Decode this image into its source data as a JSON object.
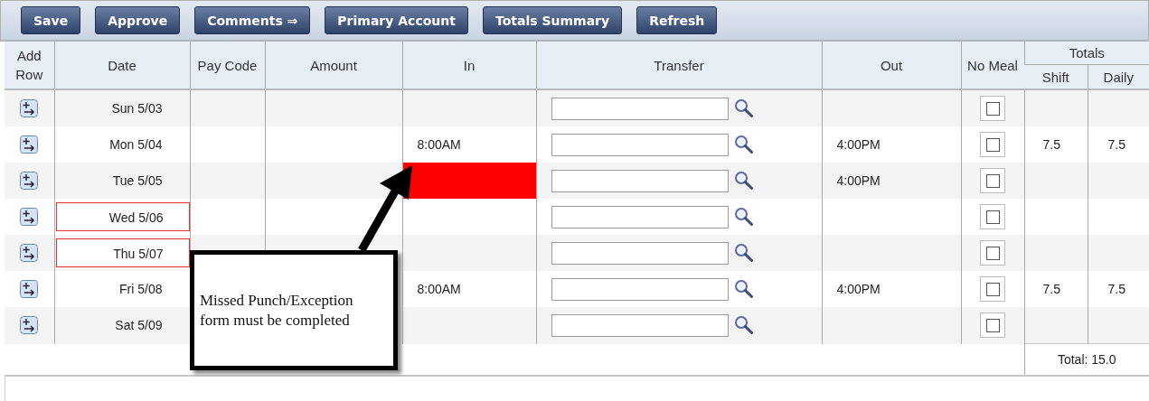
{
  "toolbar": {
    "buttons": [
      "Save",
      "Approve",
      "Comments ⇒",
      "Primary Account",
      "Totals Summary",
      "Refresh"
    ]
  },
  "table": {
    "columns": [
      "Add Row",
      "Date",
      "Pay Code",
      "Amount",
      "In",
      "Transfer",
      "Out",
      "No Meal"
    ],
    "group_header": "Totals",
    "subcolumns": [
      "Shift",
      "Daily"
    ],
    "rows": [
      {
        "date": "Sun 5/03",
        "date_flagged": false,
        "in_missing": false,
        "no_meal": false
      },
      {
        "date": "Mon 5/04",
        "date_flagged": false,
        "in_missing": false,
        "in": "8:00AM",
        "out": "4:00PM",
        "no_meal": false,
        "shift": "7.5",
        "daily": "7.5"
      },
      {
        "date": "Tue 5/05",
        "date_flagged": false,
        "in_missing": true,
        "out": "4:00PM",
        "no_meal": false
      },
      {
        "date": "Wed 5/06",
        "date_flagged": true,
        "in_missing": false,
        "no_meal": false
      },
      {
        "date": "Thu 5/07",
        "date_flagged": true,
        "in_missing": false,
        "no_meal": false
      },
      {
        "date": "Fri 5/08",
        "date_flagged": false,
        "in_missing": false,
        "in": "8:00AM",
        "out": "4:00PM",
        "no_meal": false,
        "shift": "7.5",
        "daily": "7.5"
      },
      {
        "date": "Sat 5/09",
        "date_flagged": false,
        "in_missing": false,
        "no_meal": false
      }
    ],
    "total": "Total: 15.0"
  },
  "callout": {
    "text": "Missed Punch/Exception form must be completed"
  }
}
